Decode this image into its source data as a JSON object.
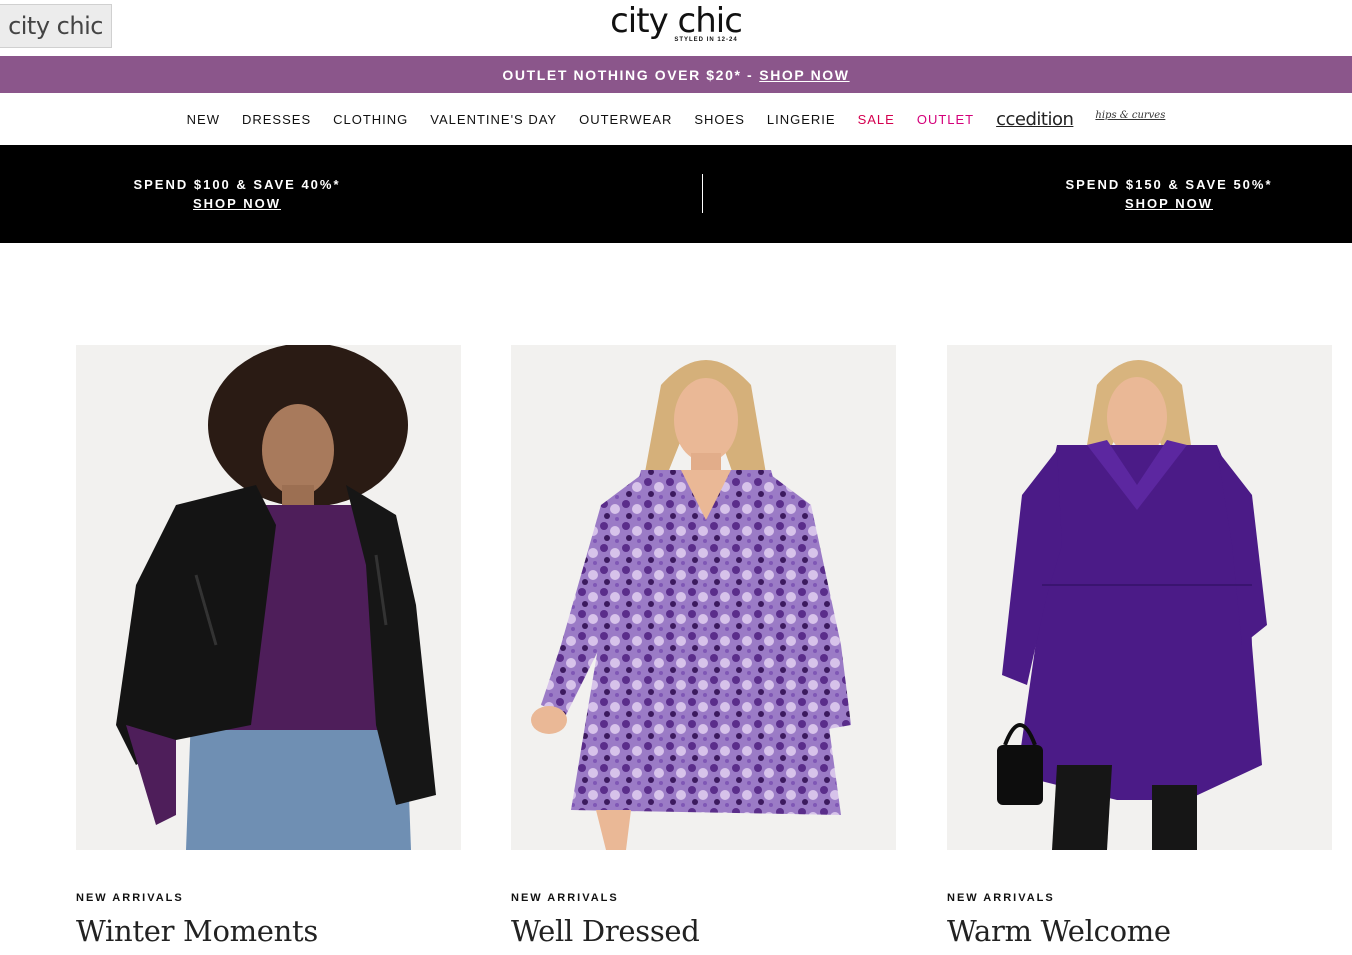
{
  "tab": {
    "logo": "city chic"
  },
  "header": {
    "brand": "city chic",
    "tagline": "STYLED IN 12-24"
  },
  "promo": {
    "text": "OUTLET NOTHING OVER $20* -",
    "link": "SHOP NOW",
    "color": "#8b568b"
  },
  "nav": {
    "items": [
      "NEW",
      "DRESSES",
      "CLOTHING",
      "VALENTINE'S DAY",
      "OUTERWEAR",
      "SHOES",
      "LINGERIE",
      "SALE",
      "OUTLET"
    ],
    "cc_edition": "ccedition",
    "hips_curves": "hips & curves"
  },
  "offers": [
    {
      "text": "SPEND $100 & SAVE 40%*",
      "link": "SHOP NOW"
    },
    {
      "text": "SPEND $150 & SAVE 50%*",
      "link": "SHOP NOW"
    }
  ],
  "cards": [
    {
      "eyebrow": "NEW ARRIVALS",
      "title": "Winter Moments"
    },
    {
      "eyebrow": "NEW ARRIVALS",
      "title": "Well Dressed"
    },
    {
      "eyebrow": "NEW ARRIVALS",
      "title": "Warm Welcome"
    }
  ]
}
